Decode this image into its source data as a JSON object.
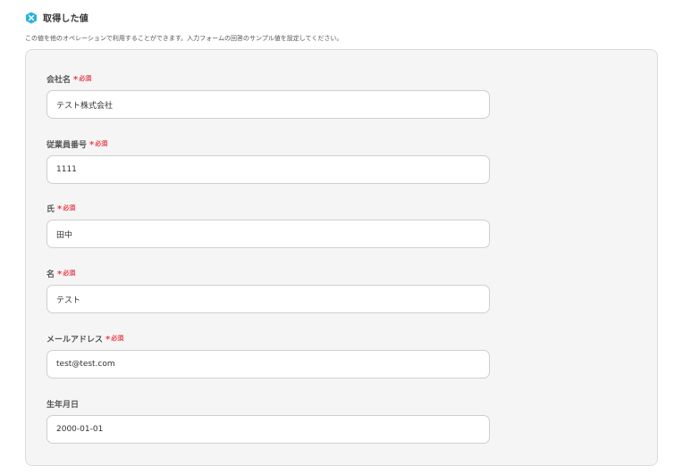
{
  "header": {
    "title": "取得した値",
    "icon": "yoom-app-icon"
  },
  "description": "この値を他のオペレーションで利用することができます。入力フォームの回答のサンプル値を設定してください。",
  "required_star": "*",
  "required_label": "必須",
  "colors": {
    "accent_icon": "#2bb3d9",
    "required": "#e8434f"
  },
  "fields": [
    {
      "label": "会社名",
      "required": true,
      "value": "テスト株式会社"
    },
    {
      "label": "従業員番号",
      "required": true,
      "value": "1111"
    },
    {
      "label": "氏",
      "required": true,
      "value": "田中"
    },
    {
      "label": "名",
      "required": true,
      "value": "テスト"
    },
    {
      "label": "メールアドレス",
      "required": true,
      "value": "test@test.com"
    },
    {
      "label": "生年月日",
      "required": false,
      "value": "2000-01-01"
    }
  ]
}
